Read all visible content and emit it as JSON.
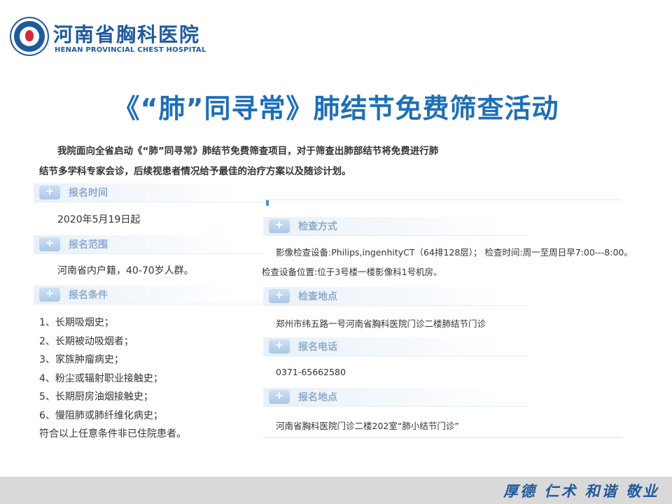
{
  "header": {
    "name_cn": "河南省胸科医院",
    "name_en": "HENAN PROVINCIAL CHEST HOSPITAL"
  },
  "title": "《“肺”同寻常》肺结节免费筛查活动",
  "intro": {
    "line1": "我院面向全省启动《“肺”同寻常》肺结节免费筛查项目，对于筛查出肺部结节将免费进行肺",
    "line2": "结节多学科专家会诊，后续视患者情况给予最佳的治疗方案以及随诊计划。"
  },
  "left": {
    "reg_time": {
      "label": "报名时间",
      "value": "2020年5月19日起"
    },
    "reg_scope": {
      "label": "报名范围",
      "value": "河南省内户籍，40-70岁人群。"
    },
    "reg_conditions": {
      "label": "报名条件",
      "items": [
        "1、长期吸烟史；",
        "2、长期被动吸烟者；",
        "3、家族肿瘤病史；",
        "4、粉尘或辐射职业接触史；",
        "5、长期厨房油烟接触史；",
        "6、慢阻肺或肺纤维化病史；",
        "符合以上任意条件非已住院患者。"
      ]
    }
  },
  "right": {
    "method": {
      "label": "检查方式",
      "line1": "影像检查设备:Philips,ingenhityCT（64排128层）；    检查时间:周一至周日早7:00---8:00。",
      "line2": "检查设备位置:位于3号楼一楼影像科1号机房。"
    },
    "place": {
      "label": "检查地点",
      "value": "郑州市纬五路一号河南省胸科医院门诊二楼肺结节门诊"
    },
    "phone": {
      "label": "报名电话",
      "value": "0371-65662580"
    },
    "reg_place": {
      "label": "报名地点",
      "value": "河南省胸科医院门诊二楼202室“肺小结节门诊”"
    }
  },
  "footer": {
    "motto": "厚德 仁术 和谐 敬业"
  },
  "colors": {
    "brand": "#1f5a9c",
    "title": "#1f6fb5",
    "section_label": "#8faccd"
  }
}
